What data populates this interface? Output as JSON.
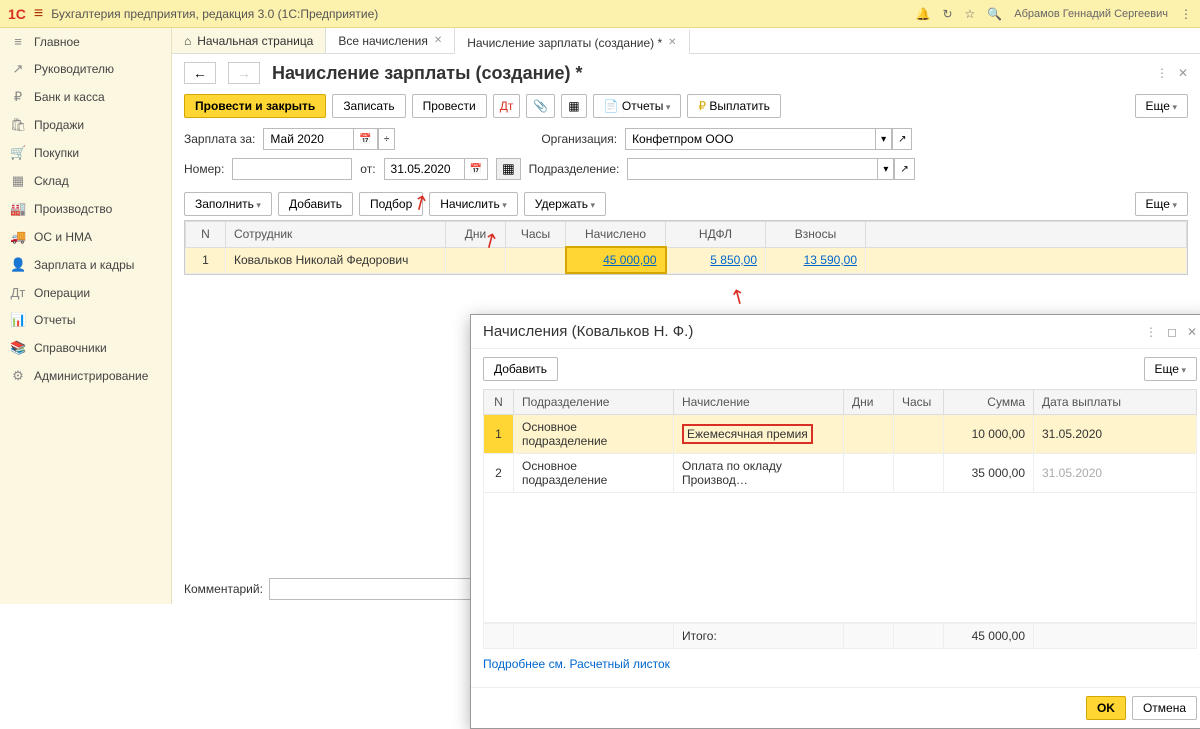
{
  "topbar": {
    "logo": "1C",
    "title": "Бухгалтерия предприятия, редакция 3.0  (1С:Предприятие)",
    "user": "Абрамов Геннадий Сергеевич"
  },
  "sidebar": [
    {
      "icon": "≡",
      "label": "Главное"
    },
    {
      "icon": "↗",
      "label": "Руководителю"
    },
    {
      "icon": "₽",
      "label": "Банк и касса"
    },
    {
      "icon": "🛍",
      "label": "Продажи"
    },
    {
      "icon": "🛒",
      "label": "Покупки"
    },
    {
      "icon": "▦",
      "label": "Склад"
    },
    {
      "icon": "🏭",
      "label": "Производство"
    },
    {
      "icon": "🚚",
      "label": "ОС и НМА"
    },
    {
      "icon": "👤",
      "label": "Зарплата и кадры"
    },
    {
      "icon": "Дт",
      "label": "Операции"
    },
    {
      "icon": "📊",
      "label": "Отчеты"
    },
    {
      "icon": "📚",
      "label": "Справочники"
    },
    {
      "icon": "⚙",
      "label": "Администрирование"
    }
  ],
  "tabs": {
    "home": "Начальная страница",
    "t1": "Все начисления",
    "t2": "Начисление зарплаты (создание) *"
  },
  "page": {
    "title": "Начисление зарплаты (создание) *",
    "buttons": {
      "post_close": "Провести и закрыть",
      "save": "Записать",
      "post": "Провести",
      "reports": "Отчеты",
      "pay": "Выплатить",
      "more": "Еще"
    },
    "form": {
      "salary_for_label": "Зарплата за:",
      "salary_for_value": "Май 2020",
      "org_label": "Организация:",
      "org_value": "Конфетпром ООО",
      "number_label": "Номер:",
      "date_label": "от:",
      "date_value": "31.05.2020",
      "dept_label": "Подразделение:"
    },
    "table_toolbar": {
      "fill": "Заполнить",
      "add": "Добавить",
      "select": "Подбор",
      "accrue": "Начислить",
      "withhold": "Удержать"
    },
    "table": {
      "headers": {
        "n": "N",
        "employee": "Сотрудник",
        "days": "Дни",
        "hours": "Часы",
        "accrued": "Начислено",
        "ndfl": "НДФЛ",
        "contrib": "Взносы"
      },
      "row": {
        "n": "1",
        "employee": "Ковальков Николай Федорович",
        "accrued": "45 000,00",
        "ndfl": "5 850,00",
        "contrib": "13 590,00"
      }
    },
    "comment_label": "Комментарий:"
  },
  "popup": {
    "title": "Начисления (Ковальков Н. Ф.)",
    "add": "Добавить",
    "more": "Еще",
    "headers": {
      "n": "N",
      "dept": "Подразделение",
      "accrual": "Начисление",
      "days": "Дни",
      "hours": "Часы",
      "sum": "Сумма",
      "paydate": "Дата выплаты"
    },
    "rows": [
      {
        "n": "1",
        "dept": "Основное подразделение",
        "accrual": "Ежемесячная премия",
        "sum": "10 000,00",
        "paydate": "31.05.2020"
      },
      {
        "n": "2",
        "dept": "Основное подразделение",
        "accrual": "Оплата по окладу Производ…",
        "sum": "35 000,00",
        "paydate": "31.05.2020"
      }
    ],
    "total_label": "Итого:",
    "total_sum": "45 000,00",
    "link": "Подробнее см. Расчетный листок",
    "ok": "OK",
    "cancel": "Отмена"
  }
}
